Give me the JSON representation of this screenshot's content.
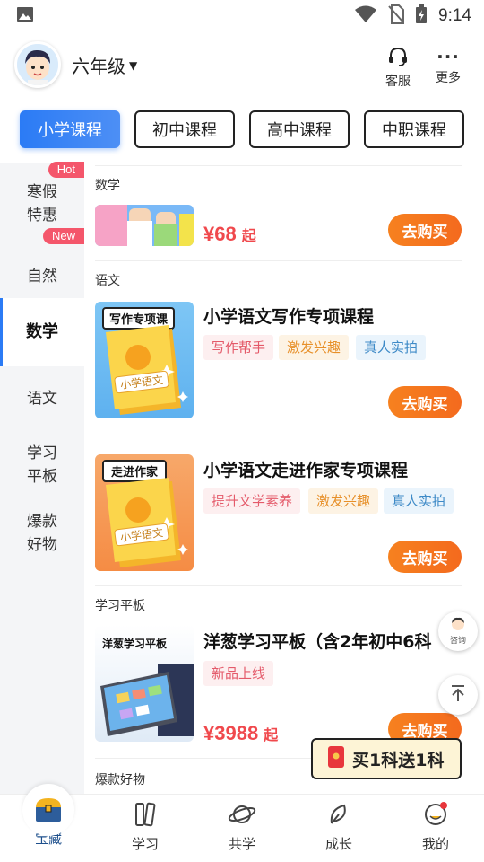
{
  "status_bar": {
    "time": "9:14"
  },
  "header": {
    "grade": "六年级",
    "service_label": "客服",
    "more_label": "更多"
  },
  "tabs": [
    {
      "label": "小学课程",
      "active": true
    },
    {
      "label": "初中课程"
    },
    {
      "label": "高中课程"
    },
    {
      "label": "中职课程"
    }
  ],
  "sidebar": {
    "items": [
      {
        "line1": "寒假",
        "line2": "特惠",
        "badge": "Hot"
      },
      {
        "label": "自然",
        "badge": "New"
      },
      {
        "label": "数学",
        "active": true
      },
      {
        "label": "语文"
      },
      {
        "line1": "学习",
        "line2": "平板"
      },
      {
        "line1": "爆款",
        "line2": "好物"
      }
    ]
  },
  "sections": [
    {
      "title": "数学",
      "product": {
        "price": "¥68",
        "price_suffix": "起",
        "buy_label": "去购买"
      }
    },
    {
      "title": "语文",
      "products": [
        {
          "thumb_label": "写作专项课",
          "book_label": "小学语文",
          "title": "小学语文写作专项课程",
          "tags": [
            "写作帮手",
            "激发兴趣",
            "真人实拍"
          ],
          "buy_label": "去购买"
        },
        {
          "thumb_label": "走进作家",
          "book_label": "小学语文",
          "title": "小学语文走进作家专项课程",
          "tags": [
            "提升文学素养",
            "激发兴趣",
            "真人实拍"
          ],
          "buy_label": "去购买"
        }
      ]
    },
    {
      "title": "学习平板",
      "product": {
        "thumb_label": "洋葱学习平板",
        "title": "洋葱学习平板（含2年初中6科",
        "tags": [
          "新品上线"
        ],
        "price": "¥3988",
        "price_suffix": "起",
        "buy_label": "去购买"
      }
    },
    {
      "title": "爆款好物"
    }
  ],
  "float": {
    "consult_label": "咨询"
  },
  "promo": {
    "label": "买1科送1科"
  },
  "bottom_nav": [
    {
      "label": "宝藏",
      "active": true
    },
    {
      "label": "学习"
    },
    {
      "label": "共学"
    },
    {
      "label": "成长"
    },
    {
      "label": "我的"
    }
  ],
  "colors": {
    "accent": "#2b7bf5",
    "buy": "#f46a1e",
    "price": "#f0494d",
    "hot": "#f4566b"
  }
}
